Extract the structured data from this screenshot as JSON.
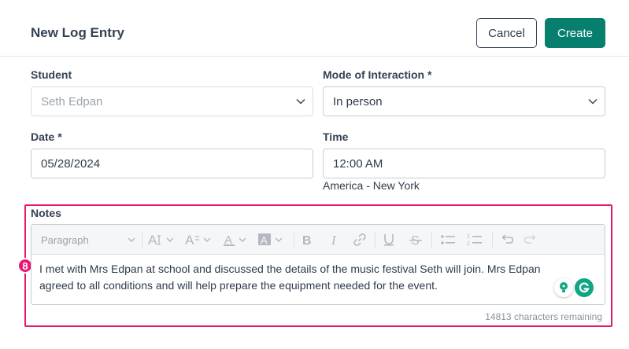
{
  "header": {
    "title": "New Log Entry",
    "cancel_label": "Cancel",
    "create_label": "Create"
  },
  "form": {
    "student": {
      "label": "Student",
      "value": "Seth Edpan",
      "disabled": true
    },
    "mode": {
      "label": "Mode of Interaction *",
      "value": "In person"
    },
    "date": {
      "label": "Date *",
      "value": "05/28/2024"
    },
    "time": {
      "label": "Time",
      "value": "12:00 AM",
      "timezone": "America - New York"
    }
  },
  "notes": {
    "label": "Notes",
    "paragraph_style": "Paragraph",
    "text": "I met with Mrs Edpan at school and discussed the details of the music festival Seth will join. Mrs Edpan agreed to all conditions and will help prepare the equipment needed for the event.",
    "remaining": "14813 characters remaining"
  },
  "annotation": {
    "badge": "8",
    "color": "#e8176f"
  },
  "colors": {
    "primary": "#077f6f",
    "text": "#344256",
    "border": "#c6ccd3",
    "grammarly": "#11a683"
  },
  "toolbar_icons": [
    "font-size-icon",
    "line-height-icon",
    "font-color-icon",
    "highlight-color-icon",
    "bold-icon",
    "italic-icon",
    "link-icon",
    "underline-icon",
    "strikethrough-icon",
    "bullet-list-icon",
    "numbered-list-icon",
    "undo-icon",
    "redo-icon"
  ]
}
